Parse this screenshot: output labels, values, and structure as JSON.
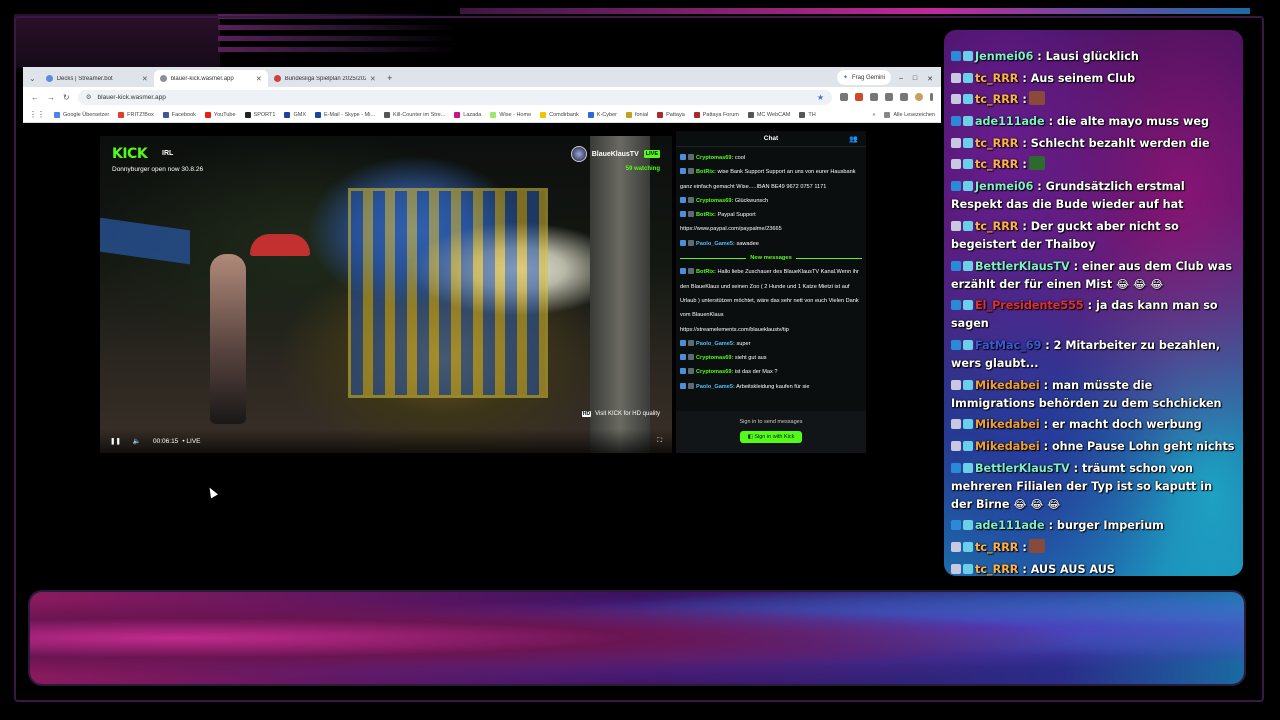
{
  "browser": {
    "tabs": [
      {
        "label": "Decks | Streamer.bot",
        "active": false
      },
      {
        "label": "blauer-kick.wasmer.app",
        "active": true
      },
      {
        "label": "Bundesliga Spielplan 2025/2026",
        "active": false
      }
    ],
    "new_tab": "+",
    "gemini_button": "Frag Gemini",
    "url": "blauer-kick.wasmer.app",
    "window_controls": [
      "–",
      "□",
      "✕"
    ],
    "bookmarks": [
      "Google Übersetzer",
      "FRITZ!Box",
      "Facebook",
      "YouTube",
      "SPORT1",
      "GMX",
      "E-Mail - Skype - Mi...",
      "Kill-Counter im Stre...",
      "Lazada",
      "Wise - Home",
      "Comdirbank",
      "K-Cyber",
      "fonial",
      "Pattaya",
      "Pattaya Forum",
      "MC WebCAM",
      "TH"
    ],
    "bookmarks_more": "»",
    "bookmarks_other": "Alle Lesezeichen"
  },
  "video": {
    "logo": "KICK",
    "category": "IRL",
    "title": "Donnyburger open now 30.8.26",
    "channel_name": "BlaueKlausTV",
    "live_badge": "LIVE",
    "viewers": "59 watching",
    "hd_text": "Visit KICK for HD quality",
    "hd_badge": "HD",
    "timestamp": "00:06:15",
    "live_label": "• LIVE"
  },
  "kick_chat": {
    "header": "Chat",
    "messages": [
      {
        "user": "Cryptomas69:",
        "text": "cool",
        "color": "#53fc18"
      },
      {
        "user": "BotRix:",
        "text": "wise Bank Support Support an uns von eurer Hausbank ganz einfach gemacht Wise.....IBAN BE49 9672 0757 1171",
        "color": "#53fc18"
      },
      {
        "user": "Cryptomas69:",
        "text": "Glückwunsch",
        "color": "#53fc18"
      },
      {
        "user": "BotRix:",
        "text": "Paypal Support",
        "color": "#53fc18",
        "link": "https://www.paypal.com/paypalme/23665"
      },
      {
        "user": "Paolo_Game5:",
        "text": "sawadee",
        "color": "#4fc3f7"
      }
    ],
    "new_messages_label": "New messages",
    "messages_after": [
      {
        "user": "BotRix:",
        "text": "Hallo liebe Zuschauer des BlaueKlausTV Kanal.Wenn ihr den BlaueKlaus und seinen Zoo ( 2 Hunde und 1 Katze Mietzi ist auf Urlaub ) unterstützen möchtet, wäre das sehr nett von euch Vielen Dank vom BlauenKlaus",
        "color": "#53fc18",
        "link": "https://streamelements.com/blaueklaustv/tip"
      },
      {
        "user": "Paolo_Game5:",
        "text": "super",
        "color": "#4fc3f7"
      },
      {
        "user": "Cryptomas69:",
        "text": "sieht gut aus",
        "color": "#53fc18"
      },
      {
        "user": "Cryptomas69:",
        "text": "ist das der Max ?",
        "color": "#53fc18"
      },
      {
        "user": "Paolo_Game5:",
        "text": "Arbeitskleidung kaufen für sie",
        "color": "#4fc3f7"
      }
    ],
    "signin_text": "Sign in to send messages",
    "signin_button": "Sign in with Kick"
  },
  "overlay_chat": {
    "messages": [
      {
        "user": "Jenmei06",
        "text": ": Lausi glücklich",
        "color": "#7ef0c8"
      },
      {
        "user": "tc_RRR",
        "text": ": Aus seinem Club",
        "color": "#ffb347"
      },
      {
        "user": "tc_RRR",
        "text": ":",
        "color": "#ffb347",
        "emote": "emote-meat"
      },
      {
        "user": "ade111ade",
        "text": ": die alte mayo muss weg",
        "color": "#7ef0c8"
      },
      {
        "user": "tc_RRR",
        "text": ": Schlecht bezahlt werden die",
        "color": "#ffb347"
      },
      {
        "user": "tc_RRR",
        "text": ":",
        "color": "#ffb347",
        "emote": "emote-pepe"
      },
      {
        "user": "Jenmei06",
        "text": ": Grundsätzlich erstmal Respekt das die Bude wieder auf hat",
        "color": "#7ef0c8"
      },
      {
        "user": "tc_RRR",
        "text": ": Der guckt aber nicht so begeistert der Thaiboy",
        "color": "#ffb347"
      },
      {
        "user": "BettlerKlausTV",
        "text": ": einer aus dem Club was erzählt der für einen Mist 😂 😂 😂",
        "color": "#7ef0c8"
      },
      {
        "user": "El_Presidente555",
        "text": ": ja das kann man so sagen",
        "color": "#e03030"
      },
      {
        "user": "FatMac_69",
        "text": ": 2 Mitarbeiter zu bezahlen, wers glaubt...",
        "color": "#3a5ad8"
      },
      {
        "user": "Mikedabei",
        "text": ": man müsste die Immigrations behörden zu dem schchicken",
        "color": "#f0a030"
      },
      {
        "user": "Mikedabei",
        "text": ": er macht doch werbung",
        "color": "#f0a030"
      },
      {
        "user": "Mikedabei",
        "text": ": ohne Pause Lohn geht nichts",
        "color": "#f0a030"
      },
      {
        "user": "BettlerKlausTV",
        "text": ": träumt schon von mehreren Filialen der Typ ist so kaputt in der Birne 😂 😂 😂",
        "color": "#7ef0c8"
      },
      {
        "user": "ade111ade",
        "text": ": burger Imperium",
        "color": "#7ef0c8"
      },
      {
        "user": "tc_RRR",
        "text": ":",
        "color": "#ffb347",
        "emote": "emote-meat"
      },
      {
        "user": "tc_RRR",
        "text": ": AUS AUS AUS",
        "color": "#ffb347"
      }
    ]
  },
  "colors": {
    "kick_green": "#53fc18",
    "overlay_gradient_top": "#3a1258",
    "overlay_gradient_bottom": "#1a7ab0"
  }
}
